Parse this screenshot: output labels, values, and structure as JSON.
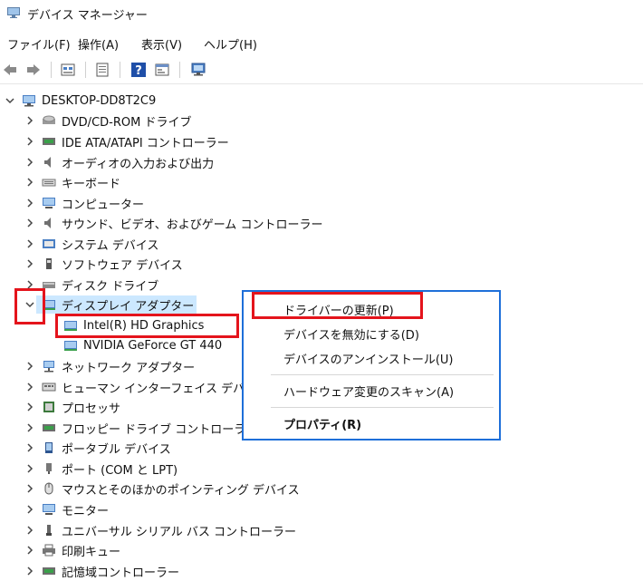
{
  "window": {
    "title": "デバイス マネージャー"
  },
  "menubar": {
    "file": "ファイル(F)",
    "action": "操作(A)",
    "view": "表示(V)",
    "help": "ヘルプ(H)"
  },
  "tree": {
    "root": "DESKTOP-DD8T2C9",
    "items": [
      "DVD/CD-ROM ドライブ",
      "IDE ATA/ATAPI コントローラー",
      "オーディオの入力および出力",
      "キーボード",
      "コンピューター",
      "サウンド、ビデオ、およびゲーム コントローラー",
      "システム デバイス",
      "ソフトウェア デバイス",
      "ディスク ドライブ",
      "ディスプレイ アダプター",
      "Intel(R) HD Graphics",
      "NVIDIA GeForce GT 440",
      "ネットワーク アダプター",
      "ヒューマン インターフェイス デバイス",
      "プロセッサ",
      "フロッピー ドライブ コントローラー",
      "ポータブル デバイス",
      "ポート (COM と LPT)",
      "マウスとそのほかのポインティング デバイス",
      "モニター",
      "ユニバーサル シリアル バス コントローラー",
      "印刷キュー",
      "記憶域コントローラー"
    ]
  },
  "context_menu": {
    "update_driver": "ドライバーの更新(P)",
    "disable_device": "デバイスを無効にする(D)",
    "uninstall_device": "デバイスのアンインストール(U)",
    "scan_hardware": "ハードウェア変更のスキャン(A)",
    "properties": "プロパティ(R)"
  },
  "colors": {
    "selection": "#cce8ff",
    "annotation": "#e4141c",
    "menu_border": "#1e6fd9"
  }
}
